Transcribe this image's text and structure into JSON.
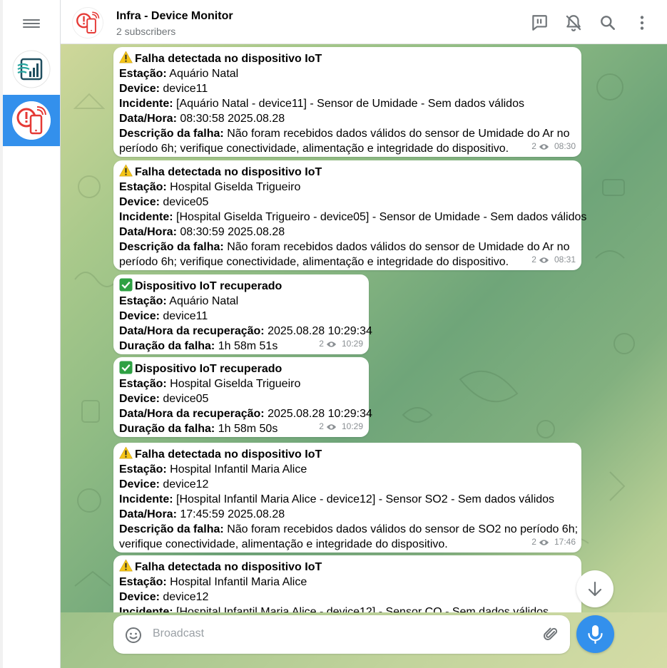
{
  "header": {
    "title": "Infra - Device Monitor",
    "subtitle": "2 subscribers"
  },
  "icons": {
    "menu": "hamburger-menu-icon",
    "discussion": "discussion-icon",
    "mute": "bell-off-icon",
    "search": "search-icon",
    "more": "more-vertical-icon",
    "views": "eye-icon",
    "emoji": "smile-icon",
    "attach": "paperclip-icon",
    "mic": "microphone-icon",
    "scroll_down": "arrow-down-icon"
  },
  "colors": {
    "accent": "#3390ec",
    "alert_red": "#e53935",
    "check_green": "#2ea043",
    "warning_yellow": "#f5c518"
  },
  "messages": [
    {
      "type": "failure",
      "title": "Falha detectada no dispositivo IoT",
      "station_label": "Estação:",
      "station": "Aquário Natal",
      "device_label": "Device:",
      "device": "device11",
      "incident_label": "Incidente:",
      "incident": "[Aquário Natal - device11] - Sensor de Umidade - Sem dados válidos",
      "datetime_label": "Data/Hora:",
      "datetime": "08:30:58 2025.08.28",
      "desc_label": "Descrição da falha:",
      "desc_line1": "Não foram recebidos dados válidos do sensor de Umidade do Ar no",
      "desc_line2": "período 6h; verifique conectividade, alimentação e integridade do dispositivo.",
      "views": "2",
      "time": "08:30"
    },
    {
      "type": "failure",
      "title": "Falha detectada no dispositivo IoT",
      "station_label": "Estação:",
      "station": "Hospital Giselda Trigueiro",
      "device_label": "Device:",
      "device": "device05",
      "incident_label": "Incidente:",
      "incident": "[Hospital Giselda Trigueiro - device05] - Sensor de Umidade - Sem dados válidos",
      "datetime_label": "Data/Hora:",
      "datetime": "08:30:59 2025.08.28",
      "desc_label": "Descrição da falha:",
      "desc_line1": "Não foram recebidos dados válidos do sensor de Umidade do Ar no",
      "desc_line2": "período 6h; verifique conectividade, alimentação e integridade do dispositivo.",
      "views": "2",
      "time": "08:31"
    },
    {
      "type": "recovery",
      "title": "Dispositivo IoT recuperado",
      "station_label": "Estação:",
      "station": "Aquário Natal",
      "device_label": "Device:",
      "device": "device11",
      "recovery_label": "Data/Hora da recuperação:",
      "recovery": "2025.08.28 10:29:34",
      "duration_label": "Duração da falha:",
      "duration": "1h 58m 51s",
      "views": "2",
      "time": "10:29"
    },
    {
      "type": "recovery",
      "title": "Dispositivo IoT recuperado",
      "station_label": "Estação:",
      "station": "Hospital Giselda Trigueiro",
      "device_label": "Device:",
      "device": "device05",
      "recovery_label": "Data/Hora da recuperação:",
      "recovery": "2025.08.28 10:29:34",
      "duration_label": "Duração da falha:",
      "duration": "1h 58m 50s",
      "views": "2",
      "time": "10:29"
    },
    {
      "type": "failure",
      "title": "Falha detectada no dispositivo IoT",
      "station_label": "Estação:",
      "station": "Hospital Infantil Maria Alice",
      "device_label": "Device:",
      "device": "device12",
      "incident_label": "Incidente:",
      "incident": "[Hospital Infantil Maria Alice - device12] - Sensor SO2 - Sem dados válidos",
      "datetime_label": "Data/Hora:",
      "datetime": "17:45:59 2025.08.28",
      "desc_label": "Descrição da falha:",
      "desc_line1": "Não foram recebidos dados válidos do sensor de SO2 no período 6h;",
      "desc_line2": "verifique conectividade, alimentação e integridade do dispositivo.",
      "views": "2",
      "time": "17:46"
    },
    {
      "type": "failure",
      "title": "Falha detectada no dispositivo IoT",
      "station_label": "Estação:",
      "station": "Hospital Infantil Maria Alice",
      "device_label": "Device:",
      "device": "device12",
      "incident_label": "Incidente:",
      "incident": "[Hospital Infantil Maria Alice - device12] - Sensor CO - Sem dados válidos"
    }
  ],
  "composer": {
    "placeholder": "Broadcast"
  }
}
